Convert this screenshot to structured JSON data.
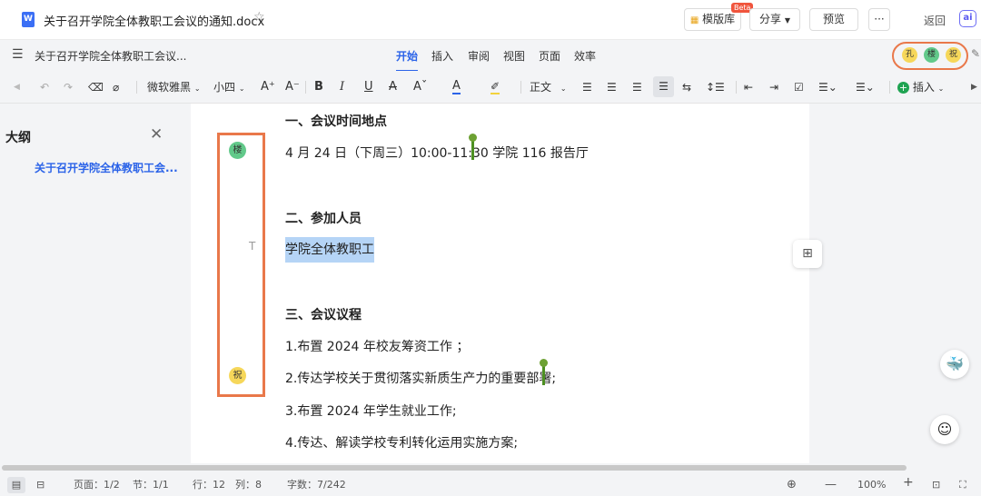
{
  "titlebar": {
    "doc_icon": "W",
    "doc_title": "关于召开学院全体教职工会议的通知.docx",
    "template_lib": "模版库",
    "beta": "Beta",
    "share": "分享",
    "preview": "预览",
    "more": "···",
    "back": "返回",
    "ai": "ai"
  },
  "menubar": {
    "short_title": "关于召开学院全体教职工会议...",
    "tabs": [
      "开始",
      "插入",
      "审阅",
      "视图",
      "页面",
      "效率"
    ],
    "active_tab": "开始",
    "collaborators": [
      "孔",
      "楼",
      "祝"
    ]
  },
  "toolbar": {
    "font": "微软雅黑",
    "size": "小四",
    "style": "正文",
    "insert": "插入"
  },
  "outline": {
    "heading": "大纲",
    "items": [
      "关于召开学院全体教职工会..."
    ]
  },
  "document": {
    "sec1_title": "一、会议时间地点",
    "sec1_line": "4 月 24 日（下周三）10:00-11:30",
    "sec1_line_tail": " 学院 116 报告厅",
    "sec2_title": "二、参加人员",
    "sec2_line": "学院全体教职工",
    "sec3_title": "三、会议议程",
    "agenda": [
      "1.布置 2024 年校友筹资工作 ；",
      "2.传达学校关于贯彻落实新质生产力的重要部署",
      "3.布置 2024 年学生就业工作;",
      "4.传达、解读学校专利转化运用实施方案;"
    ],
    "agenda2_tail": ";",
    "gutter_markers": [
      "楼",
      "祝"
    ]
  },
  "status": {
    "page": "页面：1/2",
    "section": "节：1/1",
    "row": "行：12",
    "col": "列：8",
    "words": "字数：7/242",
    "zoom": "100%"
  },
  "colors": {
    "accent": "#2b63e8",
    "annotation": "#e9784a",
    "cursor": "#4d9022",
    "selection": "#b5d4f6"
  }
}
